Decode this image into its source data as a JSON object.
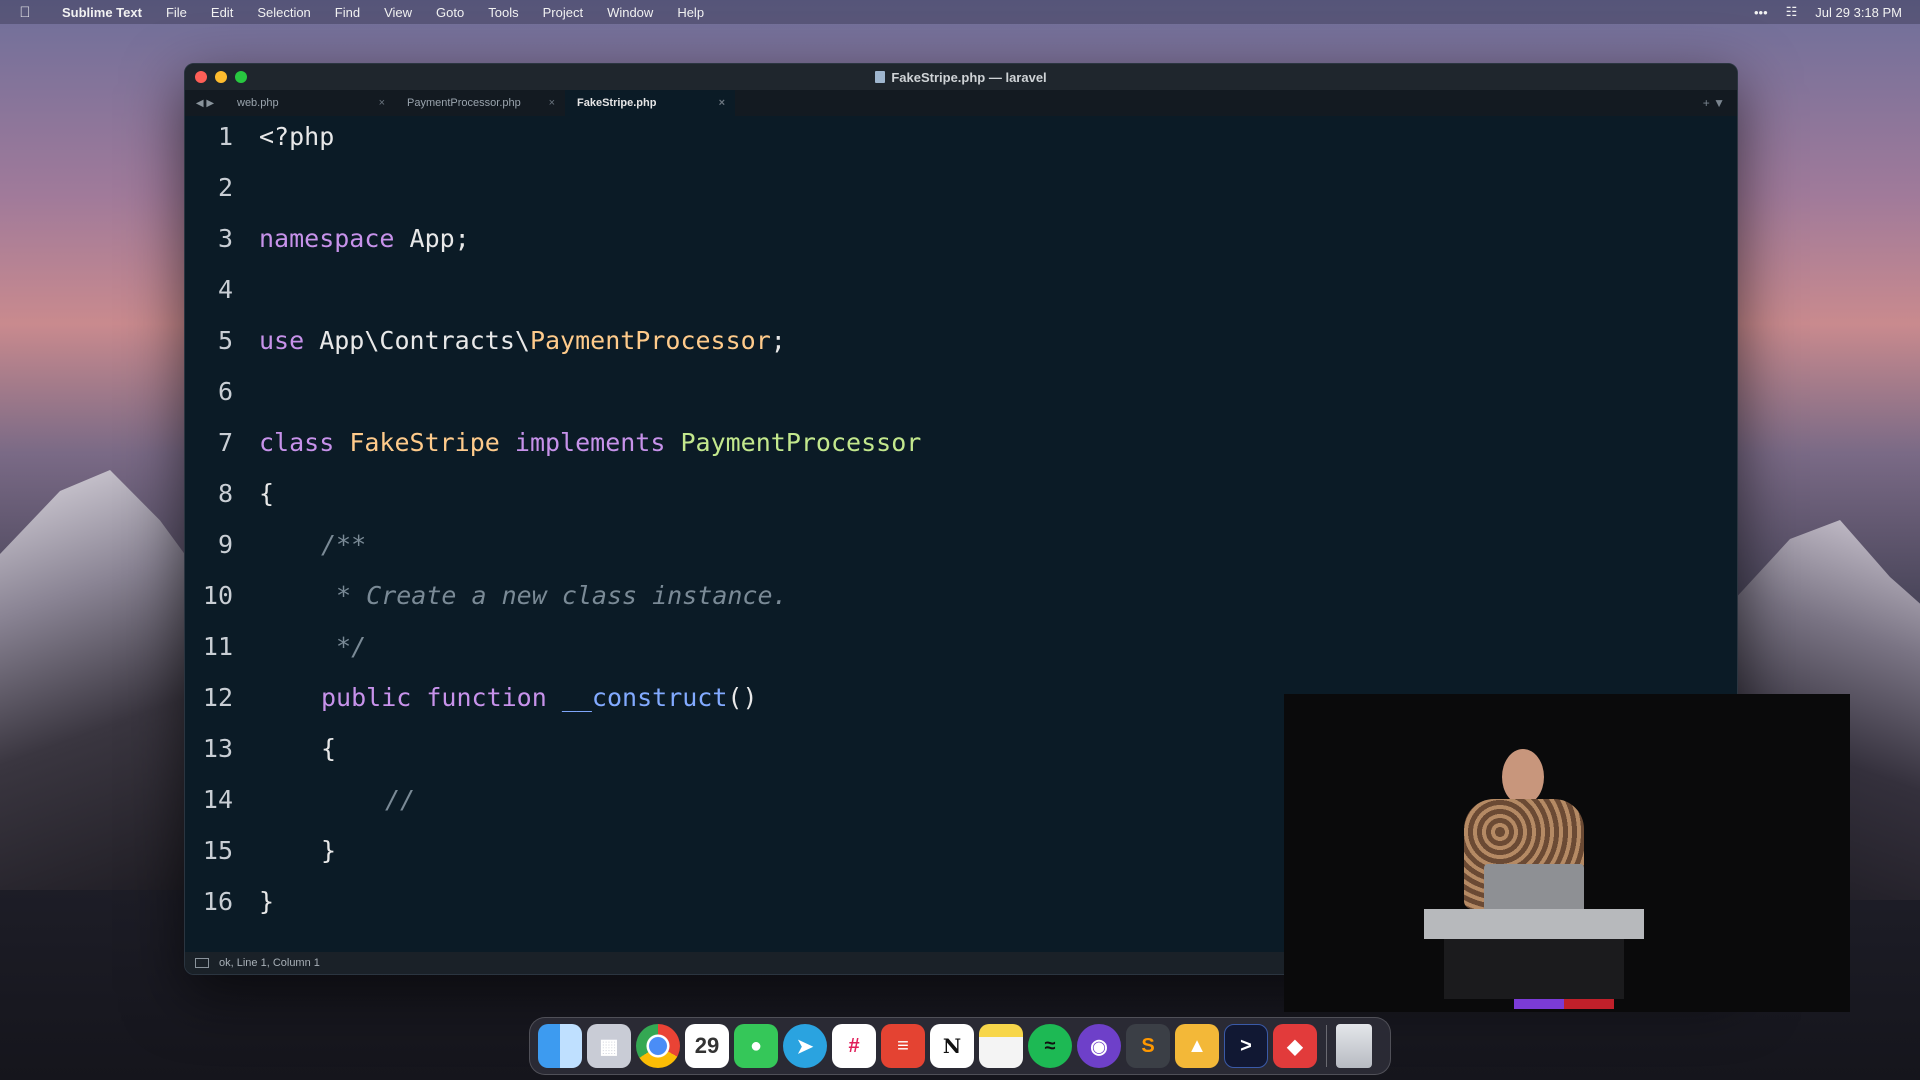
{
  "menubar": {
    "app_name": "Sublime Text",
    "items": [
      "File",
      "Edit",
      "Selection",
      "Find",
      "View",
      "Goto",
      "Tools",
      "Project",
      "Window",
      "Help"
    ],
    "more": "•••",
    "date_time": "Jul 29  3:18 PM"
  },
  "window": {
    "title": "FakeStripe.php — laravel",
    "tabs": [
      {
        "label": "web.php",
        "active": false
      },
      {
        "label": "PaymentProcessor.php",
        "active": false
      },
      {
        "label": "FakeStripe.php",
        "active": true
      }
    ],
    "tab_close": "×",
    "tab_nav": "◀ ▶",
    "tab_right": "+  ▼",
    "status": "ok, Line 1, Column 1"
  },
  "editor": {
    "line_numbers": [
      "1",
      "2",
      "3",
      "4",
      "5",
      "6",
      "7",
      "8",
      "9",
      "10",
      "11",
      "12",
      "13",
      "14",
      "15",
      "16"
    ],
    "l1": "<?php",
    "l3_kw": "namespace",
    "l3_rest": " App;",
    "l5_kw": "use",
    "l5_ns": " App\\Contracts\\",
    "l5_cls": "PaymentProcessor",
    "l5_end": ";",
    "l7_kw": "class",
    "l7_cls": " FakeStripe",
    "l7_kw2": " implements",
    "l7_iface": " PaymentProcessor",
    "l8": "{",
    "l9": "/**",
    "l10": " * Create a new class instance.",
    "l11": " */",
    "l12_kw": "public function",
    "l12_fn": " __construct",
    "l12_end": "()",
    "l13": "{",
    "l14": "//",
    "l15": "}",
    "l16": "}"
  },
  "dock": {
    "icons": [
      "finder-icon",
      "launchpad-icon",
      "chrome-icon",
      "calendar-icon",
      "messages-icon",
      "telegram-icon",
      "slack-icon",
      "todoist-icon",
      "notion-icon",
      "notes-icon",
      "spotify-icon",
      "github-desktop-icon",
      "sublime-text-icon",
      "tableplus-icon",
      "terminal-icon",
      "raycast-icon"
    ],
    "calendar_day": "29",
    "notion_letter": "N",
    "trash_icon": "trash-icon"
  }
}
